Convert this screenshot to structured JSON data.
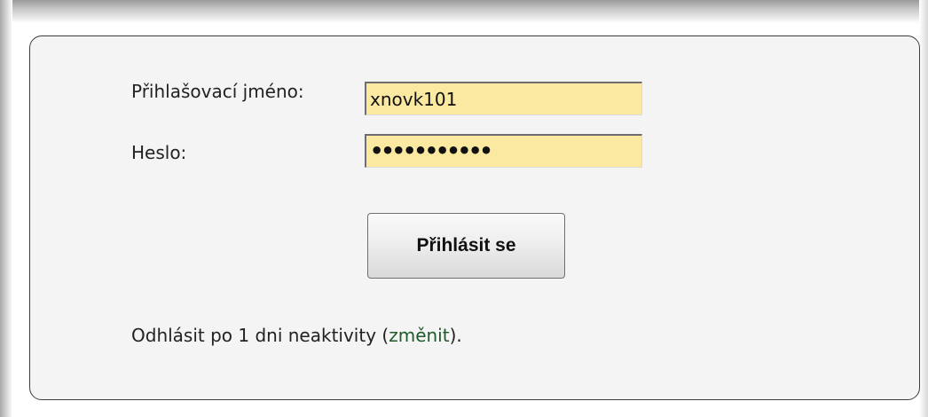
{
  "form": {
    "username_label": "Přihlašovací jméno:",
    "username_value": "xnovk101",
    "password_label": "Heslo:",
    "password_mask": "•••••••••••",
    "login_button": "Přihlásit se"
  },
  "logout_note": {
    "prefix": "Odhlásit po 1 dni neaktivity (",
    "link": "změnit",
    "suffix": ")."
  },
  "colors": {
    "field_background": "#fbe9a1",
    "link": "#1e5a2a",
    "box_background": "#f4f4f4"
  }
}
